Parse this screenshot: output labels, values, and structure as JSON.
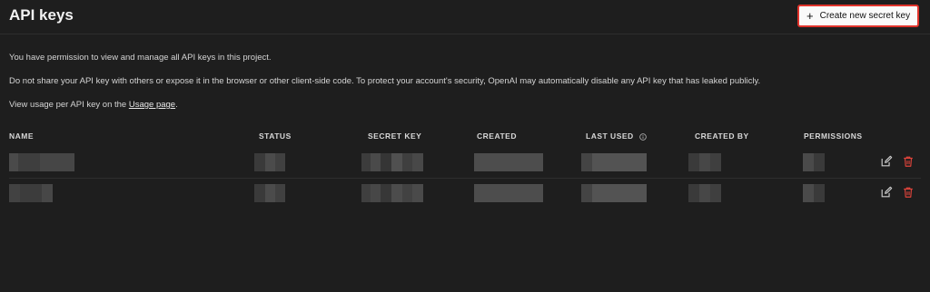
{
  "header": {
    "title": "API keys",
    "create_button": "Create new secret key",
    "create_icon": "+"
  },
  "intro": {
    "line1": "You have permission to view and manage all API keys in this project.",
    "line2": "Do not share your API key with others or expose it in the browser or other client-side code. To protect your account's security, OpenAI may automatically disable any API key that has leaked publicly.",
    "line3_prefix": "View usage per API key on the ",
    "line3_link": "Usage page",
    "line3_suffix": "."
  },
  "table": {
    "columns": [
      "NAME",
      "STATUS",
      "SECRET KEY",
      "CREATED",
      "LAST USED",
      "CREATED BY",
      "PERMISSIONS"
    ],
    "rows": [
      {
        "redacted": true
      },
      {
        "redacted": true
      }
    ]
  },
  "colors": {
    "background": "#1e1e1e",
    "delete_icon": "#e0443b",
    "highlight_border": "#e0332b"
  },
  "icons": [
    "plus-icon",
    "info-icon",
    "edit-icon",
    "trash-icon"
  ]
}
